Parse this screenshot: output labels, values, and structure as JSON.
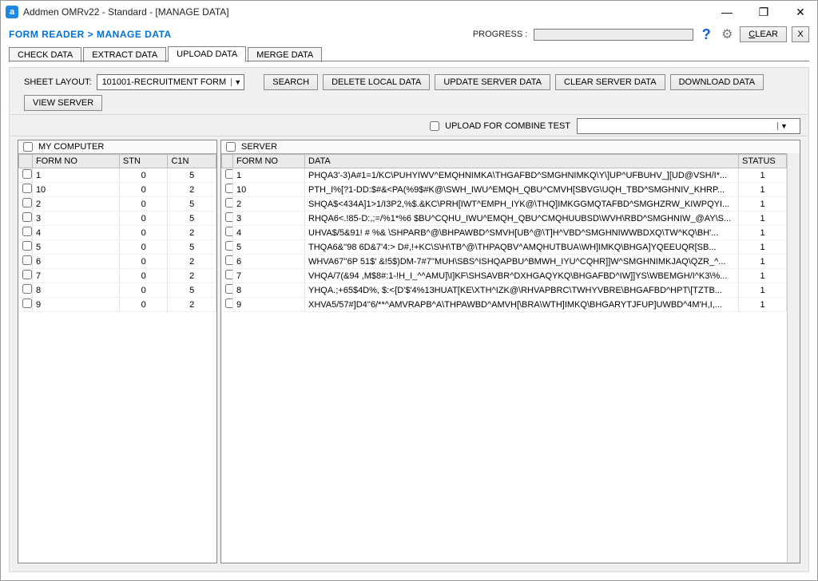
{
  "window": {
    "title": "Addmen OMRv22 - Standard - [MANAGE DATA]",
    "app_icon_glyph": "a"
  },
  "breadcrumb": "FORM READER > MANAGE DATA",
  "progress": {
    "label": "PROGRESS  :"
  },
  "header_buttons": {
    "clear": "CLEAR",
    "close_x": "X"
  },
  "tabs": [
    {
      "label": "CHECK DATA"
    },
    {
      "label": "EXTRACT DATA"
    },
    {
      "label": "UPLOAD DATA",
      "active": true
    },
    {
      "label": "MERGE DATA"
    }
  ],
  "toolbar": {
    "sheet_layout_label": "SHEET LAYOUT:",
    "sheet_layout_value": "101001-RECRUITMENT FORM",
    "search": "SEARCH",
    "delete_local": "DELETE LOCAL DATA",
    "update_server": "UPDATE SERVER DATA",
    "clear_server": "CLEAR SERVER DATA",
    "download": "DOWNLOAD DATA",
    "view_server": "VIEW SERVER"
  },
  "combine": {
    "label": "UPLOAD FOR COMBINE TEST",
    "combo_value": ""
  },
  "left_pane": {
    "title": "MY COMPUTER",
    "columns": [
      "FORM NO",
      "STN",
      "C1N"
    ],
    "rows": [
      {
        "form_no": "1",
        "stn": "0",
        "c1n": "5"
      },
      {
        "form_no": "10",
        "stn": "0",
        "c1n": "2"
      },
      {
        "form_no": "2",
        "stn": "0",
        "c1n": "5"
      },
      {
        "form_no": "3",
        "stn": "0",
        "c1n": "5"
      },
      {
        "form_no": "4",
        "stn": "0",
        "c1n": "2"
      },
      {
        "form_no": "5",
        "stn": "0",
        "c1n": "5"
      },
      {
        "form_no": "6",
        "stn": "0",
        "c1n": "2"
      },
      {
        "form_no": "7",
        "stn": "0",
        "c1n": "2"
      },
      {
        "form_no": "8",
        "stn": "0",
        "c1n": "5"
      },
      {
        "form_no": "9",
        "stn": "0",
        "c1n": "2"
      }
    ]
  },
  "right_pane": {
    "title": "SERVER",
    "columns": [
      "FORM NO",
      "DATA",
      "STATUS"
    ],
    "rows": [
      {
        "form_no": "1",
        "data": "PHQA3'-3)A#1=1/KC\\PUHYIWV^EMQHNIMKA\\THGAFBD^SMGHNIMKQ\\Y\\]UP^UFBUHV_][UD@VSH/I*...",
        "status": "1"
      },
      {
        "form_no": "10",
        "data": "PTH_I%[?1-DD:$#&<PA(%9$#K@\\SWH_IWU^EMQH_QBU^CMVH[SBVG\\UQH_TBD^SMGHNIV_KHRP...",
        "status": "1"
      },
      {
        "form_no": "2",
        "data": "SHQA$<434A]1>1/I3P2,%$.&KC\\PRH[IWT^EMPH_IYK@\\THQ]IMKGGMQTAFBD^SMGHZRW_KIWPQYI...",
        "status": "1"
      },
      {
        "form_no": "3",
        "data": "RHQA6<.!85-D:,;=/%1*%6 $BU^CQHU_IWU^EMQH_QBU^CMQHUUBSD\\WVH\\RBD^SMGHNIW_@AY\\S...",
        "status": "1"
      },
      {
        "form_no": "4",
        "data": "UHVA$/5&91! # %& \\SHPARB^@\\BHPAWBD^SMVH[UB^@\\T]H^VBD^SMGHNIWWBDXQ\\TW^KQ\\BH'...",
        "status": "1"
      },
      {
        "form_no": "5",
        "data": "THQA6&''98 6D&7'4:> D#,!+KC\\S\\H\\TB^@\\THPAQBV^AMQHUTBUA\\WH]IMKQ\\BHGA]YQEEUQR[SB...",
        "status": "1"
      },
      {
        "form_no": "6",
        "data": "WHVA67''6P 51$' &!5$)DM-7#7''MUH\\SBS^ISHQAPBU^BMWH_IYU^CQHR]]W^SMGHNIMKJAQ\\QZR_^...",
        "status": "1"
      },
      {
        "form_no": "7",
        "data": "VHQA/7(&94 ,M$8#:1-!H_I_^^AMU]\\I]KF\\SHSAVBR^DXHGAQYKQ\\BHGAFBD^IW]]YS\\WBEMGH/I^K3\\%...",
        "status": "1"
      },
      {
        "form_no": "8",
        "data": "YHQA.;+65$4D%, $:<{D'$'4%13HUAT[KE\\XTH^IZK@\\RHVAPBRC\\TWHYVBRE\\BHGAFBD^HPT\\[TZTB...",
        "status": "1"
      },
      {
        "form_no": "9",
        "data": "XHVA5/57#]D4''6/**^AMVRAPB^A\\THPAWBD^AMVH[\\BRA\\WTH]IMKQ\\BHGARYTJFUP]UWBD^4M'H,I,...",
        "status": "1"
      }
    ]
  }
}
